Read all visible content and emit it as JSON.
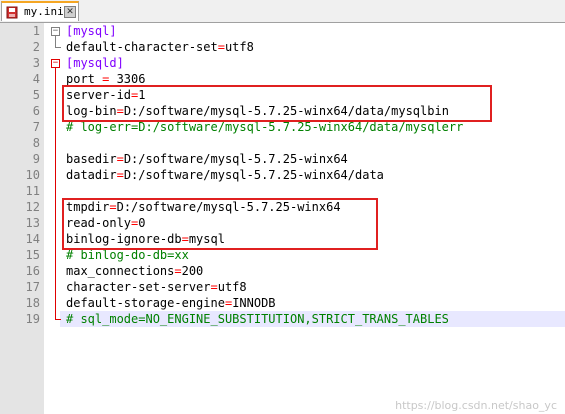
{
  "tab": {
    "label": "my.ini",
    "close_glyph": "✕",
    "icon": "save-file-icon"
  },
  "lines": [
    {
      "n": "1",
      "parts": [
        {
          "t": "[mysql]",
          "c": "section"
        }
      ]
    },
    {
      "n": "2",
      "parts": [
        {
          "t": "default-character-set",
          "c": "key"
        },
        {
          "t": "=",
          "c": "eq"
        },
        {
          "t": "utf8",
          "c": "val"
        }
      ]
    },
    {
      "n": "3",
      "parts": [
        {
          "t": "[mysqld]",
          "c": "section"
        }
      ]
    },
    {
      "n": "4",
      "parts": [
        {
          "t": "port ",
          "c": "key"
        },
        {
          "t": "=",
          "c": "eq"
        },
        {
          "t": " 3306",
          "c": "val"
        }
      ]
    },
    {
      "n": "5",
      "parts": [
        {
          "t": "server-id",
          "c": "key"
        },
        {
          "t": "=",
          "c": "eq"
        },
        {
          "t": "1",
          "c": "val"
        }
      ]
    },
    {
      "n": "6",
      "parts": [
        {
          "t": "log-bin",
          "c": "key"
        },
        {
          "t": "=",
          "c": "eq"
        },
        {
          "t": "D:/software/mysql-5.7.25-winx64/data/mysqlbin",
          "c": "val"
        }
      ]
    },
    {
      "n": "7",
      "parts": [
        {
          "t": "# log-err=D:/software/mysql-5.7.25-winx64/data/mysqlerr",
          "c": "comment"
        }
      ]
    },
    {
      "n": "8",
      "parts": []
    },
    {
      "n": "9",
      "parts": [
        {
          "t": "basedir",
          "c": "key"
        },
        {
          "t": "=",
          "c": "eq"
        },
        {
          "t": "D:/software/mysql-5.7.25-winx64",
          "c": "val"
        }
      ]
    },
    {
      "n": "10",
      "parts": [
        {
          "t": "datadir",
          "c": "key"
        },
        {
          "t": "=",
          "c": "eq"
        },
        {
          "t": "D:/software/mysql-5.7.25-winx64/data",
          "c": "val"
        }
      ]
    },
    {
      "n": "11",
      "parts": []
    },
    {
      "n": "12",
      "parts": [
        {
          "t": "tmpdir",
          "c": "key"
        },
        {
          "t": "=",
          "c": "eq"
        },
        {
          "t": "D:/software/mysql-5.7.25-winx64",
          "c": "val"
        }
      ]
    },
    {
      "n": "13",
      "parts": [
        {
          "t": "read-only",
          "c": "key"
        },
        {
          "t": "=",
          "c": "eq"
        },
        {
          "t": "0",
          "c": "val"
        }
      ]
    },
    {
      "n": "14",
      "parts": [
        {
          "t": "binlog-ignore-db",
          "c": "key"
        },
        {
          "t": "=",
          "c": "eq"
        },
        {
          "t": "mysql",
          "c": "val"
        }
      ]
    },
    {
      "n": "15",
      "parts": [
        {
          "t": "# binlog-do-db=xx",
          "c": "comment"
        }
      ]
    },
    {
      "n": "16",
      "parts": [
        {
          "t": "max_connections",
          "c": "key"
        },
        {
          "t": "=",
          "c": "eq"
        },
        {
          "t": "200",
          "c": "val"
        }
      ]
    },
    {
      "n": "17",
      "parts": [
        {
          "t": "character-set-server",
          "c": "key"
        },
        {
          "t": "=",
          "c": "eq"
        },
        {
          "t": "utf8",
          "c": "val"
        }
      ]
    },
    {
      "n": "18",
      "parts": [
        {
          "t": "default-storage-engine",
          "c": "key"
        },
        {
          "t": "=",
          "c": "eq"
        },
        {
          "t": "INNODB",
          "c": "val"
        }
      ]
    },
    {
      "n": "19",
      "parts": [
        {
          "t": "# sql_mode=NO_ENGINE_SUBSTITUTION,STRICT_TRANS_TABLES",
          "c": "comment"
        }
      ]
    }
  ],
  "current_line": "19",
  "watermark": "https://blog.csdn.net/shao_yc",
  "colors": {
    "section": "#8000ff",
    "operator": "#ff0000",
    "comment": "#008000",
    "highlight_box": "#e02020",
    "current_line_bg": "#e8e8ff"
  }
}
